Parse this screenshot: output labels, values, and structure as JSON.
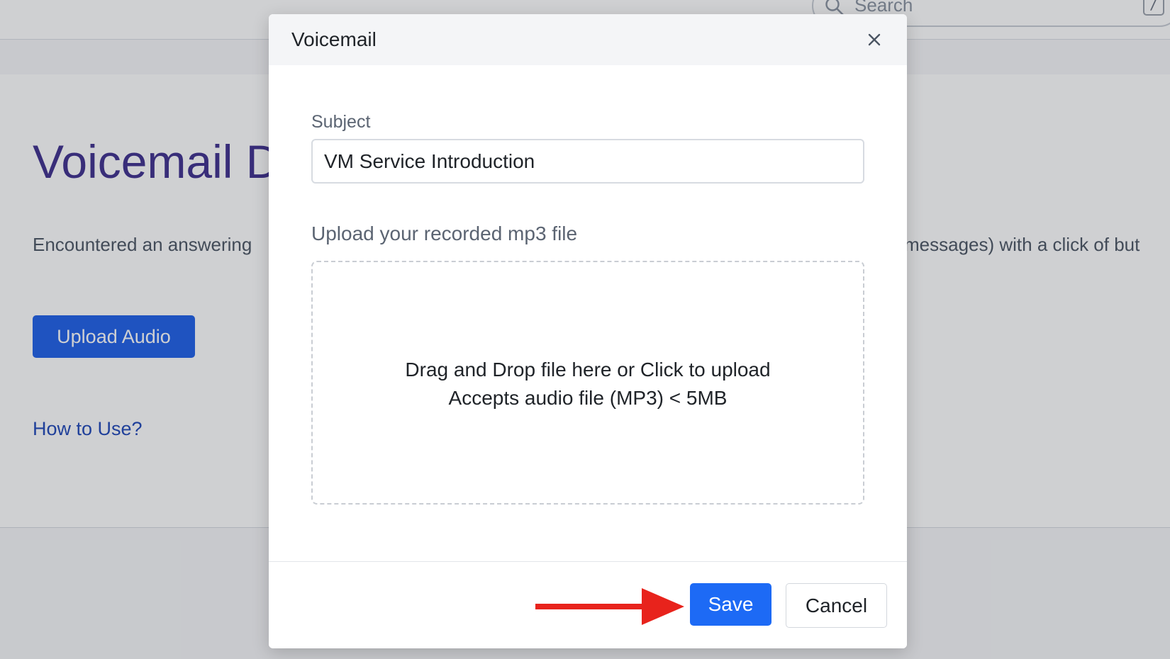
{
  "header": {
    "search_placeholder": "Search",
    "search_shortcut": "/"
  },
  "page": {
    "title": "Voicemail D",
    "description_left": "Encountered an answering",
    "description_right": "messages) with a click of but",
    "upload_button_label": "Upload Audio",
    "how_to_use_link": "How to Use?"
  },
  "modal": {
    "title": "Voicemail",
    "subject_label": "Subject",
    "subject_value": "VM Service Introduction",
    "upload_label": "Upload your recorded mp3 file",
    "dropzone_line1": "Drag and Drop file here or Click to upload",
    "dropzone_line2": "Accepts audio file (MP3) < 5MB",
    "save_label": "Save",
    "cancel_label": "Cancel"
  },
  "colors": {
    "brand_title": "#3e2f8d",
    "primary_button": "#1d6af5",
    "annotation_arrow": "#e8231c"
  },
  "icons": {
    "search": "search-icon",
    "close": "close-icon",
    "annotation": "arrow-right-icon"
  }
}
